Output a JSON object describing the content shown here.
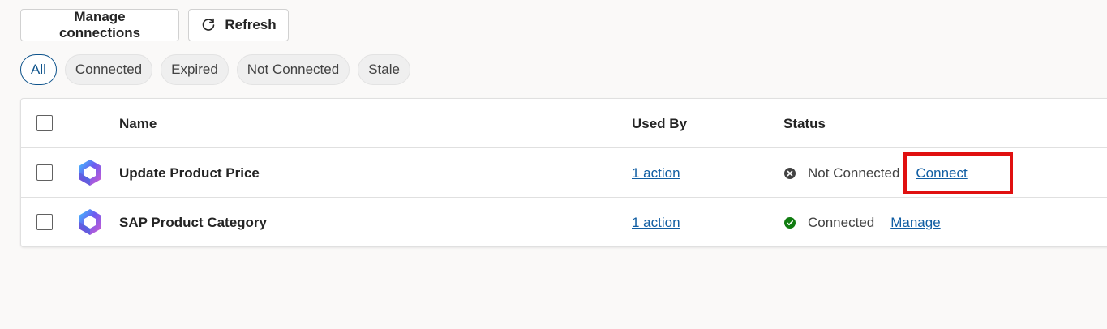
{
  "toolbar": {
    "manage_label": "Manage connections",
    "refresh_label": "Refresh"
  },
  "filters": [
    {
      "label": "All",
      "active": true
    },
    {
      "label": "Connected",
      "active": false
    },
    {
      "label": "Expired",
      "active": false
    },
    {
      "label": "Not Connected",
      "active": false
    },
    {
      "label": "Stale",
      "active": false
    }
  ],
  "table": {
    "columns": {
      "name": "Name",
      "used_by": "Used By",
      "status": "Status"
    },
    "rows": [
      {
        "name": "Update Product Price",
        "used_by": "1 action",
        "status": "Not Connected",
        "status_type": "not-connected",
        "action": "Connect"
      },
      {
        "name": "SAP Product Category",
        "used_by": "1 action",
        "status": "Connected",
        "status_type": "connected",
        "action": "Manage"
      }
    ]
  },
  "colors": {
    "connected": "#107c10",
    "not_connected": "#424242",
    "link": "#115ea3",
    "highlight": "#e01010"
  },
  "icons": {
    "refresh": "refresh-icon",
    "app": "copilot-app-icon",
    "not_connected": "dismiss-circle-icon",
    "connected": "checkmark-circle-icon"
  }
}
